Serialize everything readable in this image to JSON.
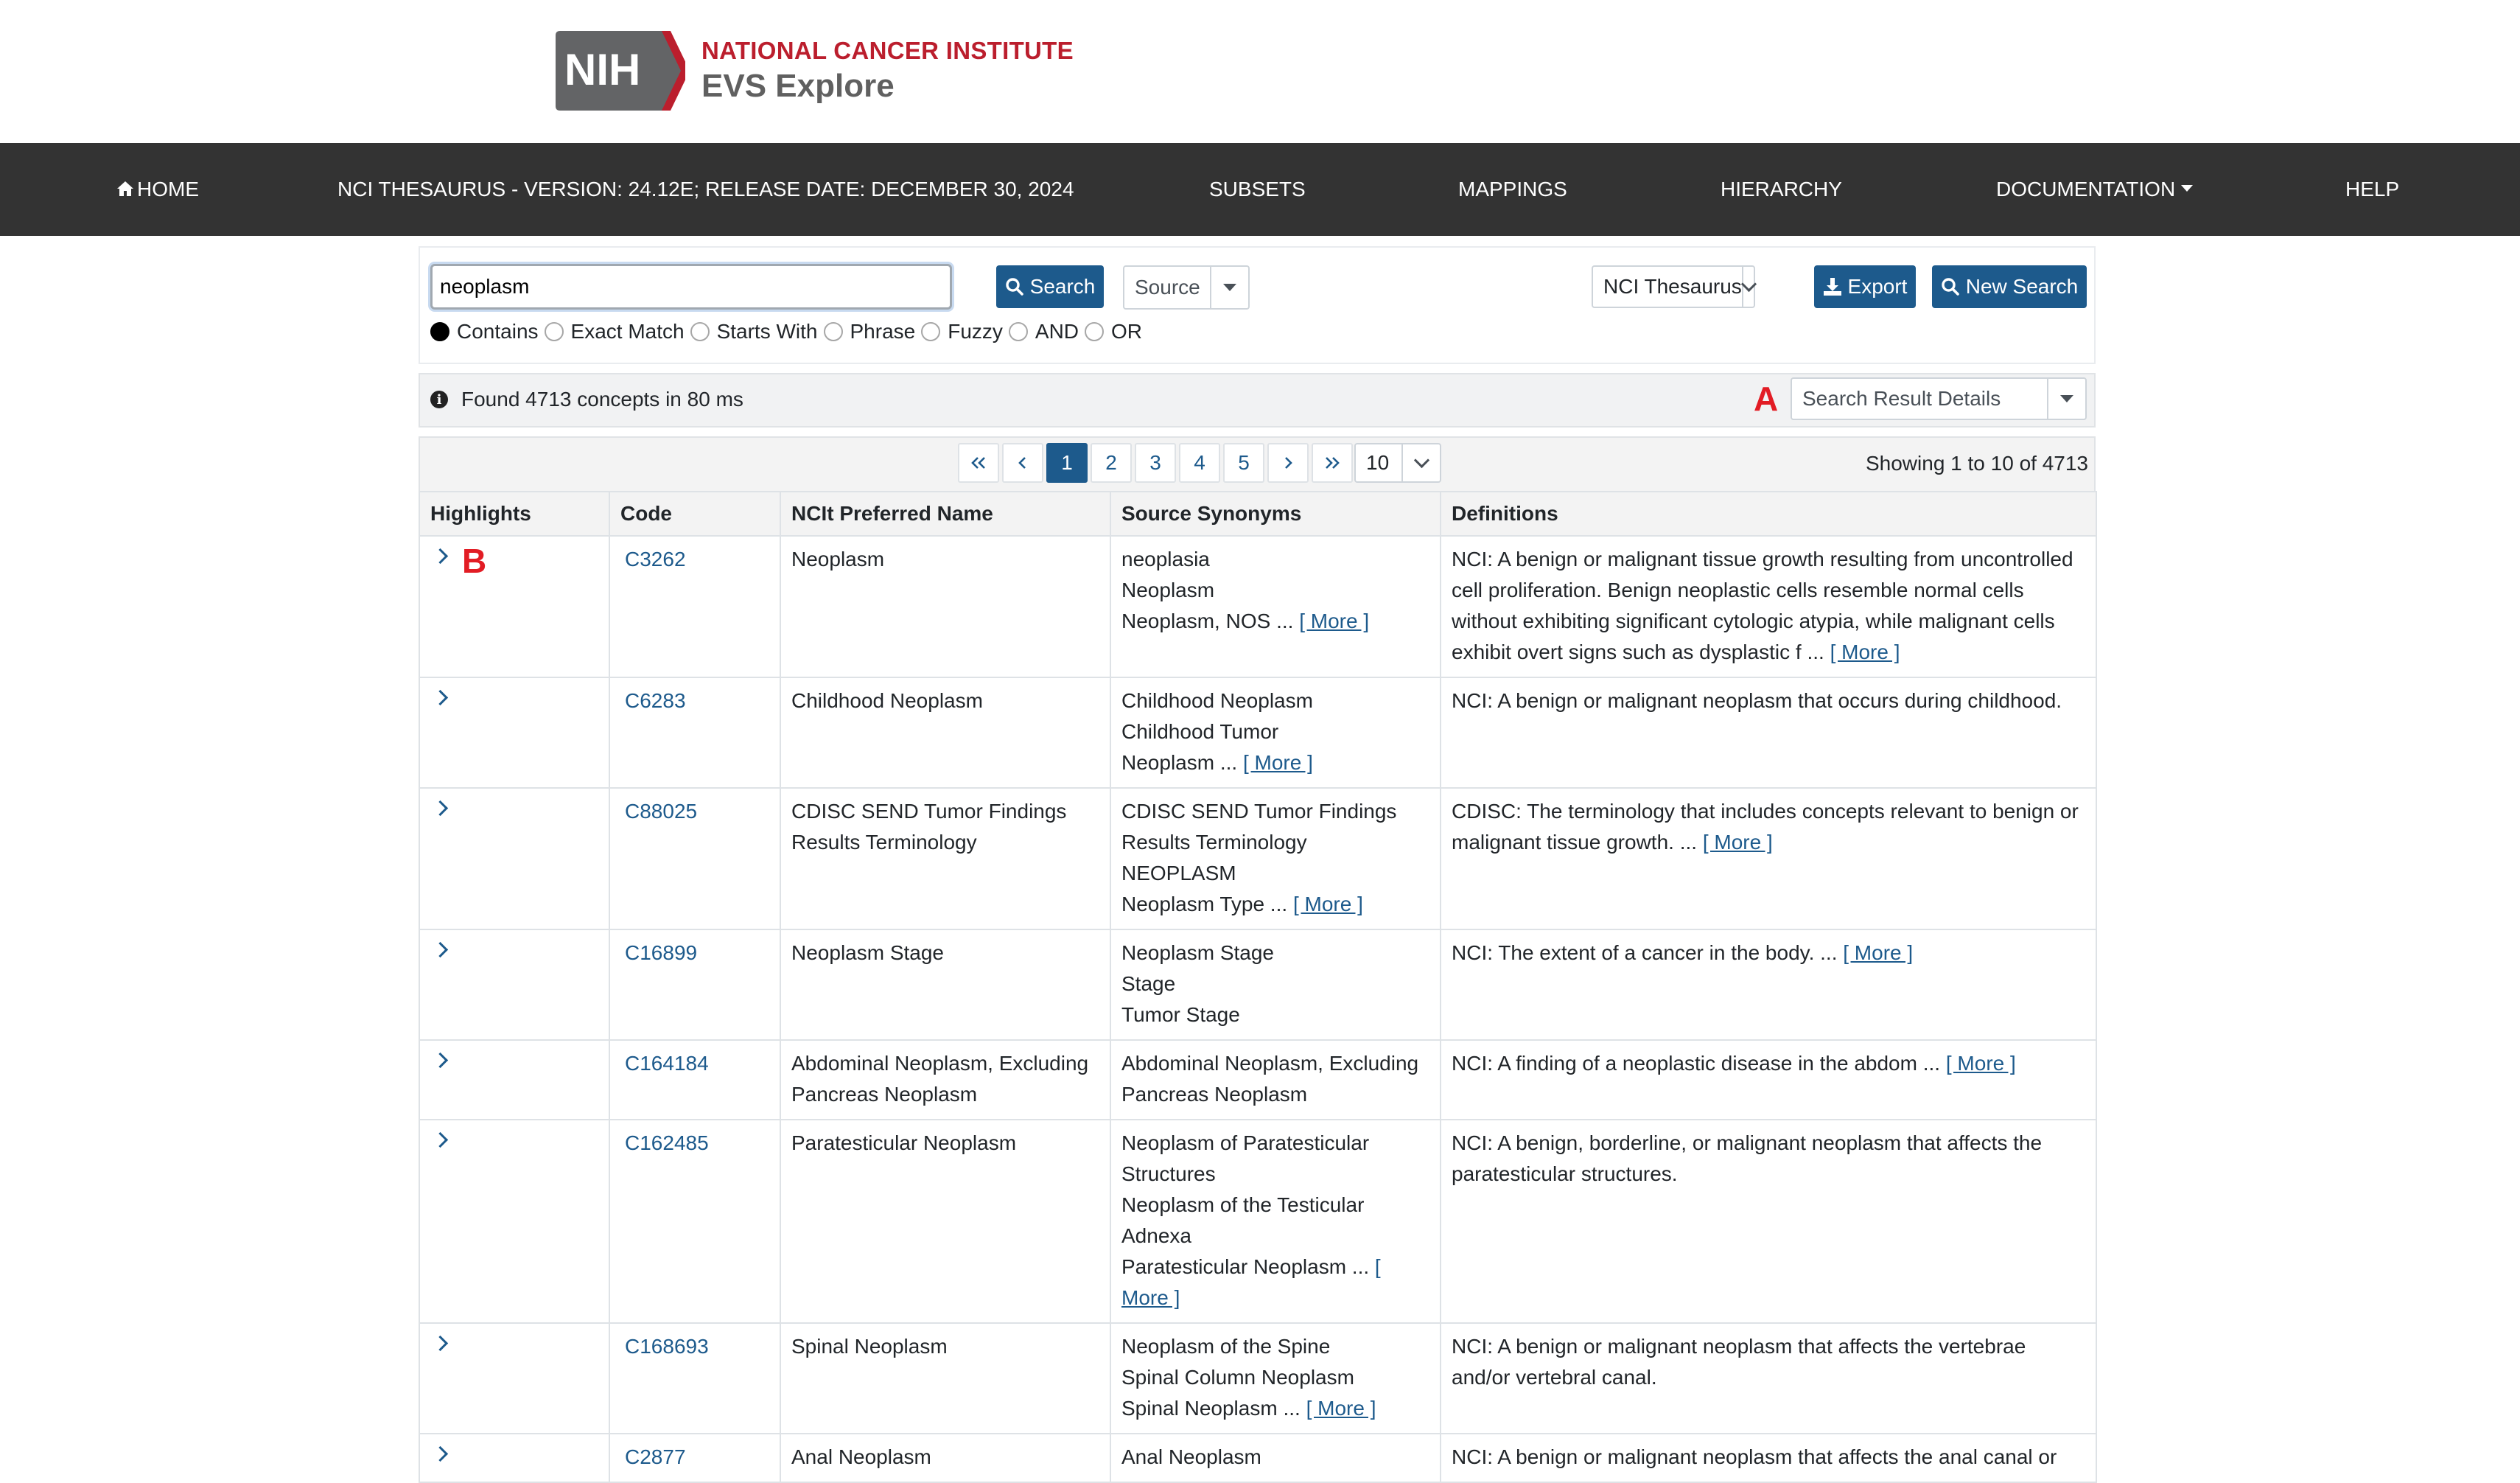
{
  "header": {
    "logo_text": "NIH",
    "org_name": "NATIONAL CANCER INSTITUTE",
    "app_name": "EVS Explore"
  },
  "nav": {
    "home": "HOME",
    "version": "NCI THESAURUS - VERSION: 24.12E; RELEASE DATE: DECEMBER 30, 2024",
    "subsets": "SUBSETS",
    "mappings": "MAPPINGS",
    "hierarchy": "HIERARCHY",
    "documentation": "DOCUMENTATION",
    "help": "HELP"
  },
  "search": {
    "value": "neoplasm",
    "search_label": "Search",
    "source_label": "Source",
    "terminology": "NCI Thesaurus",
    "export_label": "Export",
    "new_search_label": "New Search",
    "options": [
      "Contains",
      "Exact Match",
      "Starts With",
      "Phrase",
      "Fuzzy",
      "AND",
      "OR"
    ],
    "selected_option": "Contains"
  },
  "info": {
    "found_text": "Found 4713 concepts in 80 ms",
    "details_label": "Search Result Details",
    "marker_a": "A",
    "marker_b": "B"
  },
  "pagination": {
    "first": "«",
    "prev": "‹",
    "pages": [
      "1",
      "2",
      "3",
      "4",
      "5"
    ],
    "current": "1",
    "next": "›",
    "last": "»",
    "page_size": "10",
    "showing": "Showing 1 to 10 of 4713"
  },
  "table": {
    "headers": [
      "Highlights",
      "Code",
      "NCIt Preferred Name",
      "Source Synonyms",
      "Definitions"
    ],
    "more": "[ More ]",
    "rows": [
      {
        "code": "C3262",
        "name": "Neoplasm",
        "synonyms": [
          "neoplasia",
          "Neoplasm",
          "Neoplasm, NOS ..."
        ],
        "definition": "NCI: A benign or malignant tissue growth resulting from uncontrolled cell proliferation. Benign neoplastic cells resemble normal cells without exhibiting significant cytologic atypia, while malignant cells exhibit overt signs such as dysplastic f ..."
      },
      {
        "code": "C6283",
        "name": "Childhood Neoplasm",
        "synonyms": [
          "Childhood Neoplasm",
          "Childhood Tumor",
          "Neoplasm ..."
        ],
        "definition": "NCI: A benign or malignant neoplasm that occurs during childhood."
      },
      {
        "code": "C88025",
        "name": "CDISC SEND Tumor Findings Results Terminology",
        "synonyms": [
          "CDISC SEND Tumor Findings Results Terminology",
          "NEOPLASM",
          "Neoplasm Type ..."
        ],
        "definition": "CDISC: The terminology that includes concepts relevant to benign or malignant tissue growth. ..."
      },
      {
        "code": "C16899",
        "name": "Neoplasm Stage",
        "synonyms": [
          "Neoplasm Stage",
          "Stage",
          "Tumor Stage"
        ],
        "definition": "NCI: The extent of a cancer in the body. ..."
      },
      {
        "code": "C164184",
        "name": "Abdominal Neoplasm, Excluding Pancreas Neoplasm",
        "synonyms": [
          "Abdominal Neoplasm, Excluding Pancreas Neoplasm"
        ],
        "definition": "NCI: A finding of a neoplastic disease in the abdom ..."
      },
      {
        "code": "C162485",
        "name": "Paratesticular Neoplasm",
        "synonyms": [
          "Neoplasm of Paratesticular Structures",
          "Neoplasm of the Testicular Adnexa",
          "Paratesticular Neoplasm ..."
        ],
        "definition": "NCI: A benign, borderline, or malignant neoplasm that affects the paratesticular structures."
      },
      {
        "code": "C168693",
        "name": "Spinal Neoplasm",
        "synonyms": [
          "Neoplasm of the Spine",
          "Spinal Column Neoplasm",
          "Spinal Neoplasm ..."
        ],
        "definition": "NCI: A benign or malignant neoplasm that affects the vertebrae and/or vertebral canal."
      },
      {
        "code": "C2877",
        "name": "Anal Neoplasm",
        "synonyms": [
          "Anal Neoplasm"
        ],
        "definition": "NCI: A benign or malignant neoplasm that affects the anal canal or"
      }
    ]
  }
}
